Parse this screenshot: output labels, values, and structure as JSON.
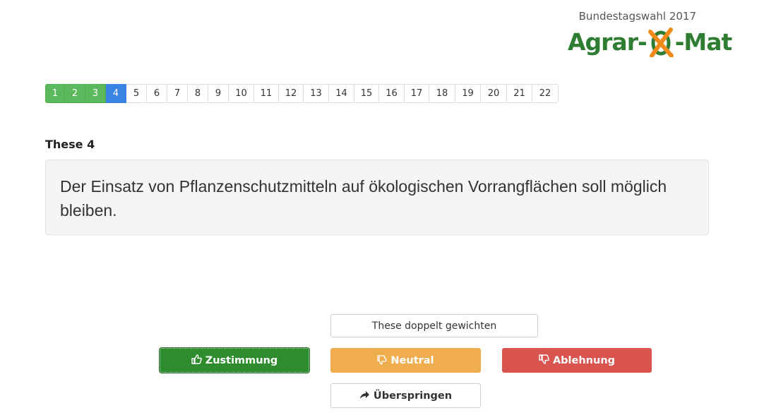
{
  "logo": {
    "subtitle": "Bundestagswahl 2017",
    "title_left": "Agrar-",
    "title_right": "-Mat",
    "brand_green": "#2e7d32",
    "brand_orange": "#f08a1a"
  },
  "pagination": {
    "pages": [
      "1",
      "2",
      "3",
      "4",
      "5",
      "6",
      "7",
      "8",
      "9",
      "10",
      "11",
      "12",
      "13",
      "14",
      "15",
      "16",
      "17",
      "18",
      "19",
      "20",
      "21",
      "22"
    ],
    "done_color": "#5cb85c",
    "active_color": "#3a82e4"
  },
  "thesis": {
    "label": "These 4",
    "text": "Der Einsatz von Pflanzenschutzmitteln auf ökologischen Vorrangflächen soll möglich bleiben."
  },
  "actions": {
    "double_weight": "These doppelt gewichten",
    "agree": "Zustimmung",
    "agree_icon": "thumbs-up-icon",
    "neutral": "Neutral",
    "neutral_icon": "thumbs-sideways-icon",
    "disagree": "Ablehnung",
    "disagree_icon": "thumbs-down-icon",
    "skip": "Überspringen",
    "skip_icon": "share-arrow-icon",
    "agree_color": "#2e8b2e",
    "neutral_color": "#f0ad4e",
    "disagree_color": "#d9534f"
  }
}
